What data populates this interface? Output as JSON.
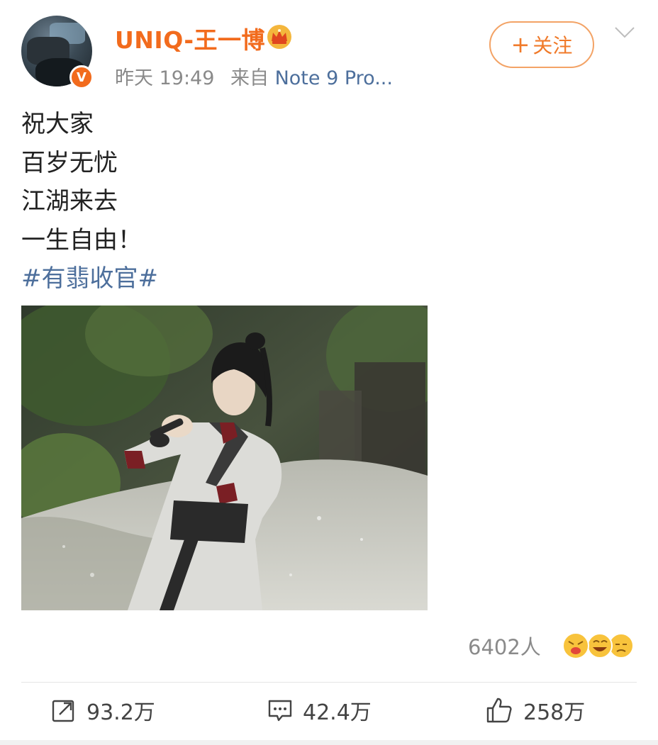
{
  "post": {
    "username": "UNIQ-王一博",
    "time": "昨天 19:49",
    "source_prefix": "来自",
    "source": "Note 9 Pro...",
    "follow_label": "关注",
    "lines": [
      "祝大家",
      "百岁无忧",
      "江湖来去",
      "一生自由！"
    ],
    "hashtag": "#有翡收官#"
  },
  "reactions": {
    "count": "6402人"
  },
  "actions": {
    "repost": "93.2万",
    "comment": "42.4万",
    "like": "258万"
  },
  "colors": {
    "username": "#f26b1d",
    "link": "#4d6f9c",
    "meta": "#8a8a8a",
    "follow_border": "#f3a366"
  },
  "icons": [
    "verified-badge-icon",
    "crown-icon",
    "chevron-down-icon",
    "repost-icon",
    "comment-icon",
    "like-icon"
  ]
}
